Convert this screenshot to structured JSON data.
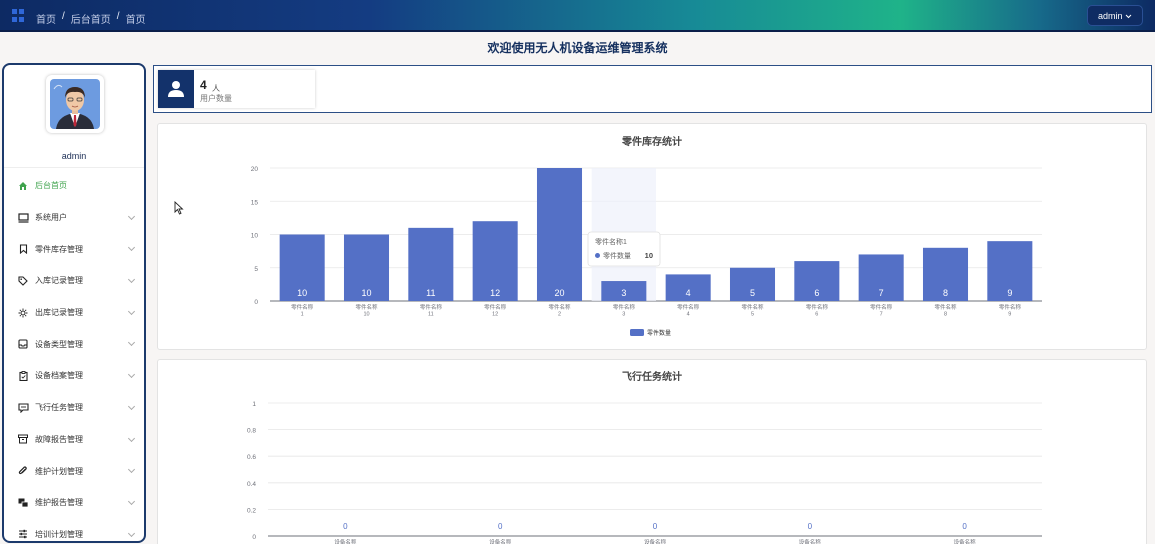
{
  "header": {
    "breadcrumbs": [
      "首页",
      "后台首页",
      "首页"
    ],
    "admin_button": "admin"
  },
  "page_title": "欢迎使用无人机设备运维管理系统",
  "sidebar": {
    "username": "admin",
    "items": [
      {
        "label": "后台首页",
        "icon": "home-icon",
        "active": true
      },
      {
        "label": "系统用户",
        "icon": "monitor-icon"
      },
      {
        "label": "零件库存管理",
        "icon": "bookmark-icon"
      },
      {
        "label": "入库记录管理",
        "icon": "tag-icon"
      },
      {
        "label": "出库记录管理",
        "icon": "sun-icon"
      },
      {
        "label": "设备类型管理",
        "icon": "inbox-icon"
      },
      {
        "label": "设备档案管理",
        "icon": "clipboard-icon"
      },
      {
        "label": "飞行任务管理",
        "icon": "message-icon"
      },
      {
        "label": "故障报告管理",
        "icon": "archive-icon"
      },
      {
        "label": "维护计划管理",
        "icon": "paperclip-icon"
      },
      {
        "label": "维护报告管理",
        "icon": "chat-icon"
      },
      {
        "label": "培训计划管理",
        "icon": "sliders-icon"
      }
    ]
  },
  "stats": {
    "count": "4",
    "unit": "人",
    "label": "用户数量"
  },
  "chart_data": [
    {
      "type": "bar",
      "title": "零件库存统计",
      "categories": [
        "零件名称\n1",
        "零件名称\n10",
        "零件名称\n11",
        "零件名称\n12",
        "零件名称\n2",
        "零件名称\n3",
        "零件名称\n4",
        "零件名称\n5",
        "零件名称\n6",
        "零件名称\n7",
        "零件名称\n8",
        "零件名称\n9"
      ],
      "series": [
        {
          "name": "零件数量",
          "values": [
            10,
            10,
            11,
            12,
            20,
            3,
            4,
            5,
            6,
            7,
            8,
            9
          ]
        }
      ],
      "ylim": [
        0,
        20
      ],
      "yticks": [
        0,
        5,
        10,
        15,
        20
      ],
      "color": "#5470c6",
      "legend": "bottom",
      "grid": true,
      "tooltip": {
        "title": "零件名称1",
        "series": "零件数量",
        "value": "10"
      }
    },
    {
      "type": "bar",
      "title": "飞行任务统计",
      "categories": [
        "设备名称",
        "设备名称",
        "设备名称",
        "设备名称",
        "设备名称"
      ],
      "series": [
        {
          "values": [
            0,
            0,
            0,
            0,
            0
          ]
        }
      ],
      "ylim": [
        0,
        1
      ],
      "yticks": [
        0,
        0.2,
        0.4,
        0.6,
        0.8,
        1
      ],
      "color": "#5470c6",
      "grid": true
    }
  ],
  "colors": {
    "accent": "#13326b",
    "active_menu": "#3fa34d",
    "bar": "#5470c6"
  }
}
